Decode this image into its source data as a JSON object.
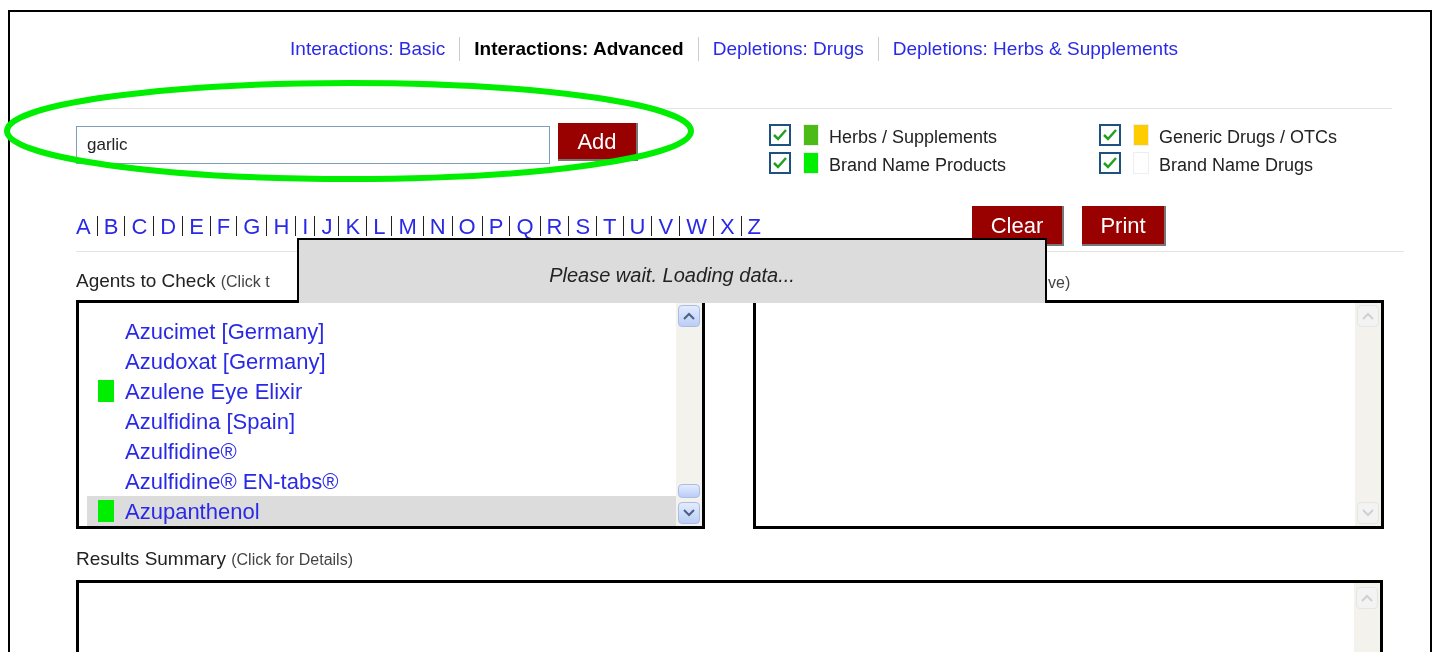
{
  "tabs": [
    {
      "label": "Interactions: Basic",
      "selected": false
    },
    {
      "label": "Interactions: Advanced",
      "selected": true
    },
    {
      "label": "Depletions: Drugs",
      "selected": false
    },
    {
      "label": "Depletions: Herbs & Supplements",
      "selected": false
    }
  ],
  "search": {
    "value": "garlic",
    "button": "Add"
  },
  "filters": [
    {
      "label": "Herbs / Supplements",
      "checked": true,
      "color": "#4cbb17"
    },
    {
      "label": "Generic Drugs / OTCs",
      "checked": true,
      "color": "#ffcc00"
    },
    {
      "label": "Brand Name Products",
      "checked": true,
      "color": "#00ee00"
    },
    {
      "label": "Brand Name Drugs",
      "checked": true,
      "color": "#ffffff"
    }
  ],
  "letters": [
    "A",
    "B",
    "C",
    "D",
    "E",
    "F",
    "G",
    "H",
    "I",
    "J",
    "K",
    "L",
    "M",
    "N",
    "O",
    "P",
    "Q",
    "R",
    "S",
    "T",
    "U",
    "V",
    "W",
    "X",
    "Z"
  ],
  "actions": [
    "Clear",
    "Print"
  ],
  "loading": "Please wait. Loading data...",
  "agents_label": {
    "title": "Agents to Check",
    "hint": "(Click t"
  },
  "selected_label": {
    "hint": "ve)"
  },
  "agents": [
    {
      "name": "Azucimet [Germany]",
      "selected": false
    },
    {
      "name": "Azudoxat [Germany]",
      "selected": false
    },
    {
      "name": "Azulene Eye Elixir",
      "selected": false,
      "color": "#00ee00"
    },
    {
      "name": "Azulfidina [Spain]",
      "selected": false
    },
    {
      "name": "Azulfidine®",
      "selected": false
    },
    {
      "name": "Azulfidine® EN-tabs®",
      "selected": false
    },
    {
      "name": "Azupanthenol",
      "selected": true,
      "color": "#00ee00"
    }
  ],
  "results_label": {
    "title": "Results Summary",
    "hint": "(Click for Details)"
  }
}
